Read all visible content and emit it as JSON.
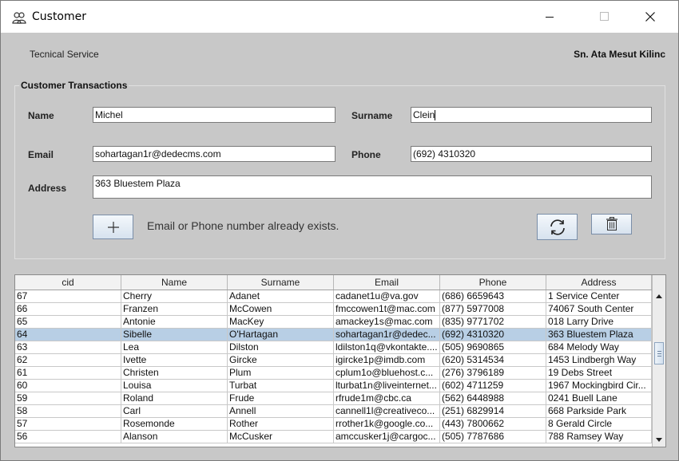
{
  "window": {
    "title": "Customer",
    "icon": "users-icon",
    "controls": [
      "minimize-icon",
      "maximize-icon",
      "close-icon"
    ]
  },
  "header": {
    "left_text": "Tecnical Service",
    "right_text": "Sn. Ata Mesut Kilinc"
  },
  "form": {
    "group_title": "Customer Transactions",
    "name_label": "Name",
    "name_value": "Michel",
    "surname_label": "Surname",
    "surname_value": "Clein",
    "email_label": "Email",
    "email_value": "sohartagan1r@dedecms.com",
    "phone_label": "Phone",
    "phone_value": "(692) 4310320",
    "address_label": "Address",
    "address_value": "363 Bluestem Plaza",
    "add_button_icon": "plus-icon",
    "message": "Email or Phone number already exists.",
    "refresh_button_icon": "refresh-icon",
    "delete_button_icon": "trash-icon"
  },
  "table": {
    "columns": [
      "cid",
      "Name",
      "Surname",
      "Email",
      "Phone",
      "Address"
    ],
    "selected_cid": "64",
    "rows": [
      [
        "67",
        "Cherry",
        "Adanet",
        "cadanet1u@va.gov",
        "(686) 6659643",
        "1 Service Center"
      ],
      [
        "66",
        "Franzen",
        "McCowen",
        "fmccowen1t@mac.com",
        "(877) 5977008",
        "74067 South Center"
      ],
      [
        "65",
        "Antonie",
        "MacKey",
        "amackey1s@mac.com",
        "(835) 9771702",
        "018 Larry Drive"
      ],
      [
        "64",
        "Sibelle",
        "O'Hartagan",
        "sohartagan1r@dedec...",
        "(692) 4310320",
        "363 Bluestem Plaza"
      ],
      [
        "63",
        "Lea",
        "Dilston",
        "ldilston1q@vkontakte....",
        "(505) 9690865",
        "684 Melody Way"
      ],
      [
        "62",
        "Ivette",
        "Gircke",
        "igircke1p@imdb.com",
        "(620) 5314534",
        "1453 Lindbergh Way"
      ],
      [
        "61",
        "Christen",
        "Plum",
        "cplum1o@bluehost.c...",
        "(276) 3796189",
        "19 Debs Street"
      ],
      [
        "60",
        "Louisa",
        "Turbat",
        "lturbat1n@liveinternet...",
        "(602) 4711259",
        "1967 Mockingbird Cir..."
      ],
      [
        "59",
        "Roland",
        "Frude",
        "rfrude1m@cbc.ca",
        "(562) 6448988",
        "0241 Buell Lane"
      ],
      [
        "58",
        "Carl",
        "Annell",
        "cannell1l@creativeco...",
        "(251) 6829914",
        "668 Parkside Park"
      ],
      [
        "57",
        "Rosemonde",
        "Rother",
        "rrother1k@google.co...",
        "(443) 7800662",
        "8 Gerald Circle"
      ],
      [
        "56",
        "Alanson",
        "McCusker",
        "amccusker1j@cargoc...",
        "(505) 7787686",
        "788 Ramsey Way"
      ]
    ]
  },
  "colors": {
    "background": "#c8c8c8",
    "selection": "#b8cfe5",
    "button_border": "#7a8ea8"
  }
}
